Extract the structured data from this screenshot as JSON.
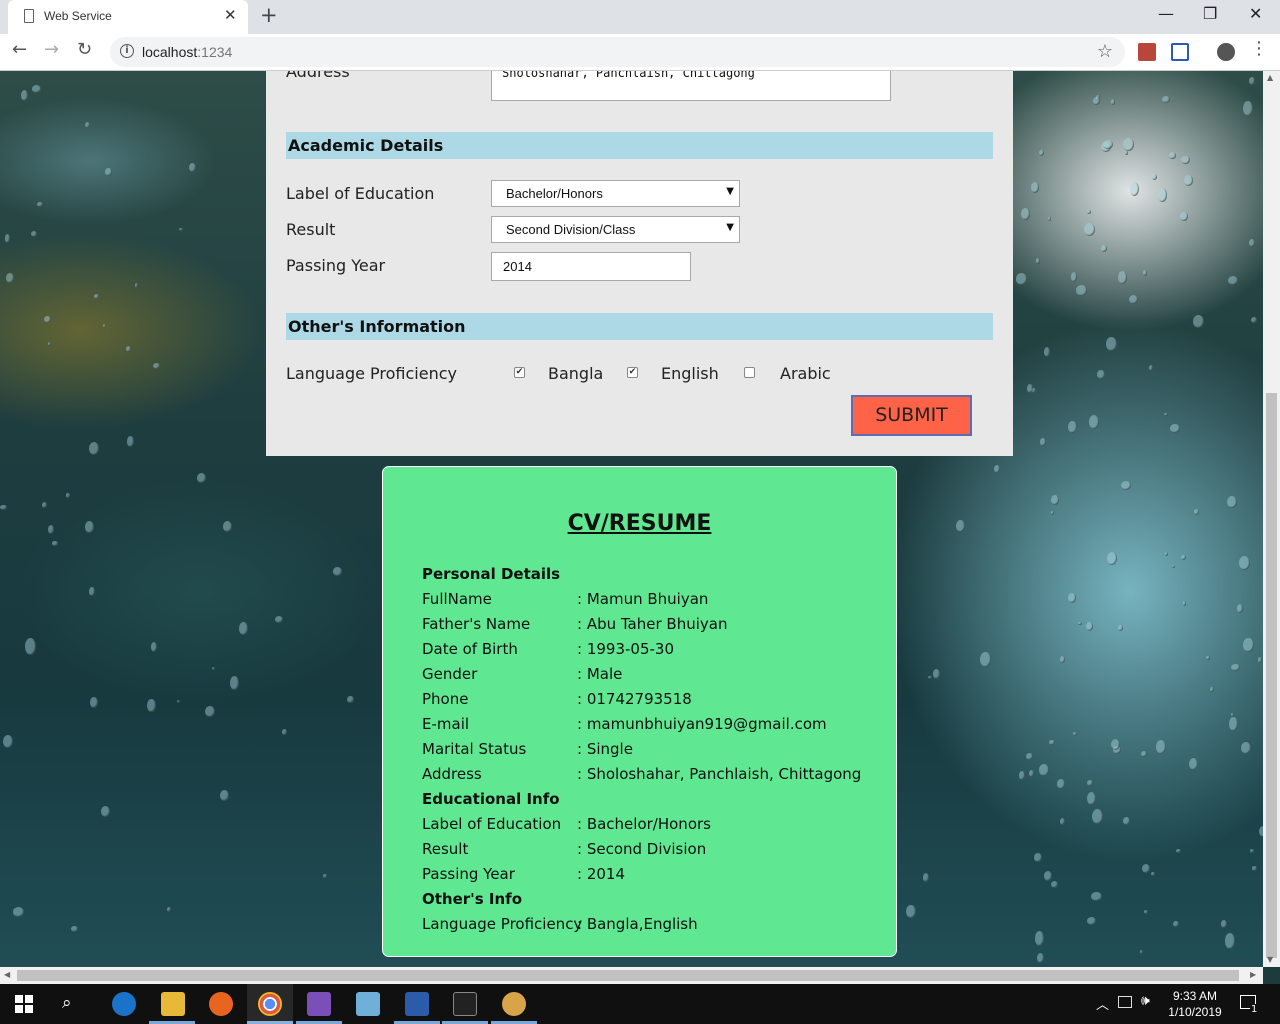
{
  "browser": {
    "tab_title": "Web Service",
    "tab_close": "✕",
    "new_tab": "+",
    "url_host": "localhost",
    "url_port": ":1234",
    "window_controls": {
      "minimize": "—",
      "restore": "❐",
      "close": "✕"
    },
    "nav": {
      "back": "←",
      "forward": "→",
      "reload": "↻"
    },
    "star": "☆"
  },
  "form": {
    "address_label": "Address",
    "address_value": "Sholoshahar, Panchlaish, Chittagong",
    "academic_header": "Academic Details",
    "education_label": "Label of Education",
    "education_value": "Bachelor/Honors",
    "result_label": "Result",
    "result_value": "Second Division/Class",
    "passing_year_label": "Passing Year",
    "passing_year_value": "2014",
    "other_header": "Other's Information",
    "language_label": "Language Proficiency",
    "languages": [
      {
        "name": "Bangla",
        "checked": true
      },
      {
        "name": "English",
        "checked": true
      },
      {
        "name": "Arabic",
        "checked": false
      }
    ],
    "submit_label": "SUBMIT",
    "select_arrow": "▼"
  },
  "cv": {
    "title": "CV/RESUME",
    "personal_header": "Personal Details",
    "personal": [
      {
        "key": "FullName",
        "value": ": Mamun Bhuiyan"
      },
      {
        "key": "Father's Name",
        "value": ": Abu Taher Bhuiyan"
      },
      {
        "key": "Date of Birth",
        "value": ": 1993-05-30"
      },
      {
        "key": "Gender",
        "value": ": Male"
      },
      {
        "key": "Phone",
        "value": ": 01742793518"
      },
      {
        "key": "E-mail",
        "value": ": mamunbhuiyan919@gmail.com"
      },
      {
        "key": "Marital Status",
        "value": ": Single"
      },
      {
        "key": "Address",
        "value": ": Sholoshahar, Panchlaish, Chittagong"
      }
    ],
    "education_header": "Educational Info",
    "education": [
      {
        "key": "Label of Education",
        "value": ": Bachelor/Honors"
      },
      {
        "key": "Result",
        "value": ": Second Division"
      },
      {
        "key": "Passing Year",
        "value": ": 2014"
      }
    ],
    "other_header": "Other's Info",
    "other": [
      {
        "key": "Language Proficiency",
        "value": ": Bangla,English"
      }
    ]
  },
  "taskbar": {
    "time": "9:33 AM",
    "date": "1/10/2019",
    "notification_count": "1"
  }
}
